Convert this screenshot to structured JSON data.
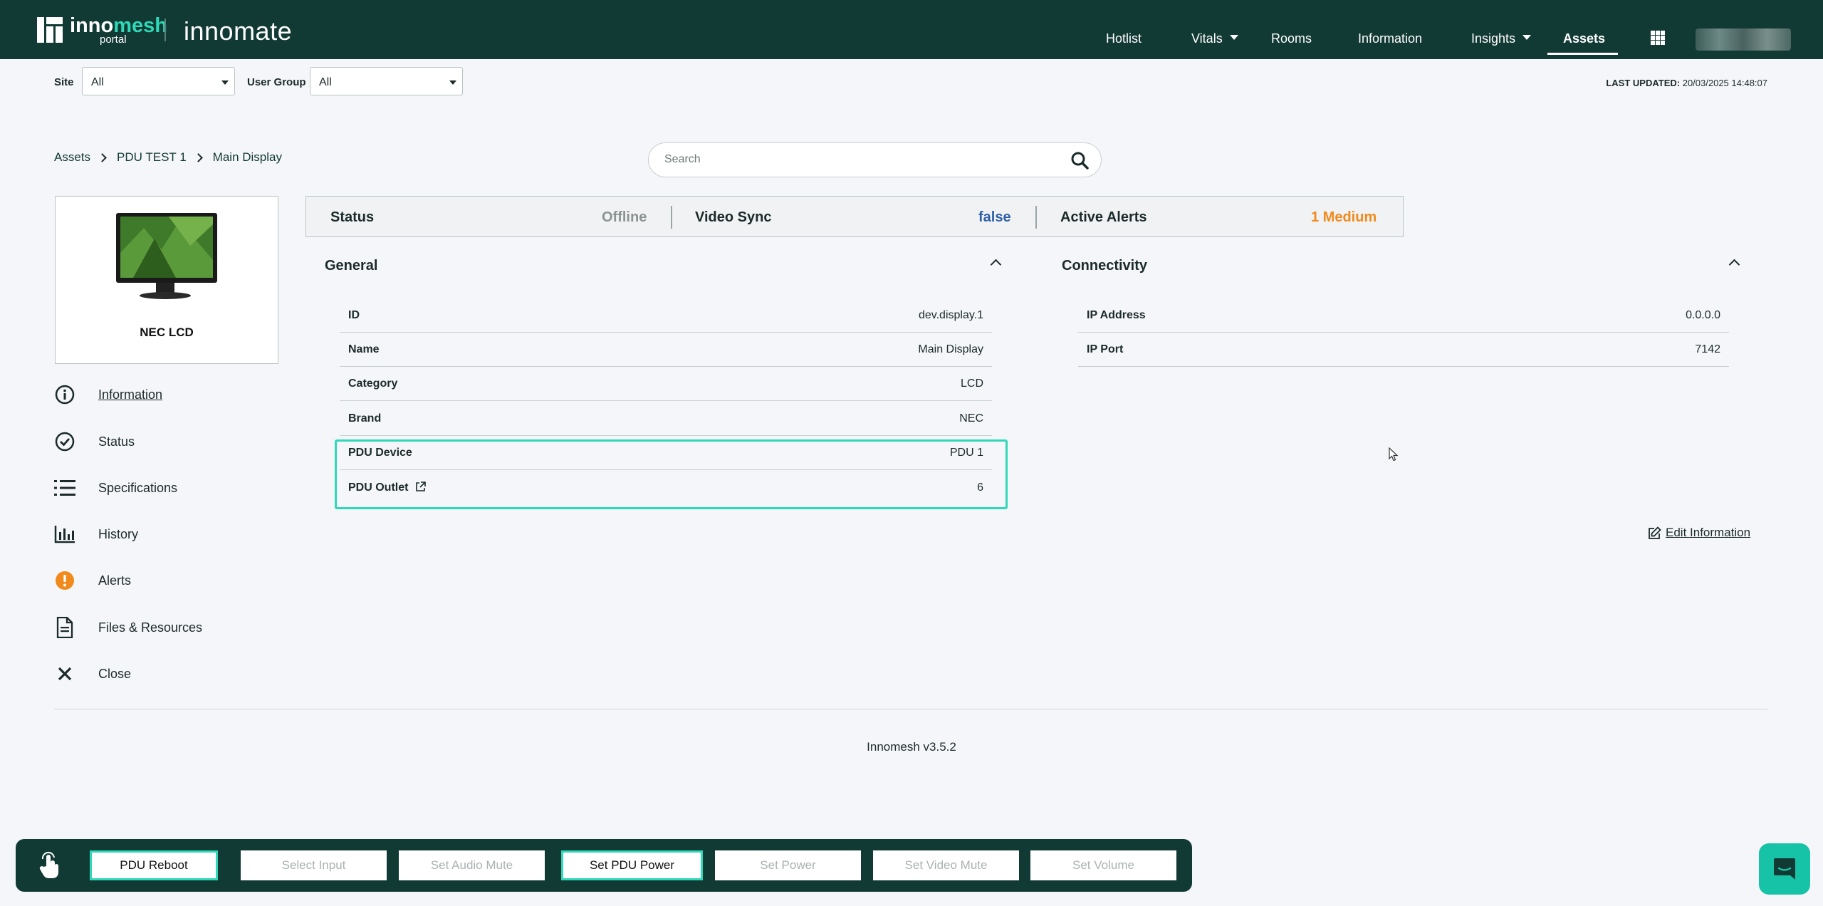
{
  "header": {
    "logo_inno": "inno",
    "logo_mesh": "mesh",
    "logo_portal": "portal",
    "app_name": "innomate",
    "nav": [
      {
        "label": "Hotlist",
        "dropdown": false
      },
      {
        "label": "Vitals",
        "dropdown": true
      },
      {
        "label": "Rooms",
        "dropdown": false
      },
      {
        "label": "Information",
        "dropdown": false
      },
      {
        "label": "Insights",
        "dropdown": true
      },
      {
        "label": "Assets",
        "dropdown": false,
        "active": true
      }
    ],
    "apps_icon": "grid-icon"
  },
  "filters": {
    "site_label": "Site",
    "site_value": "All",
    "user_group_label": "User Group",
    "user_group_value": "All",
    "last_updated_label": "LAST UPDATED:",
    "last_updated_value": "20/03/2025 14:48:07"
  },
  "breadcrumb": [
    "Assets",
    "PDU TEST 1",
    "Main Display"
  ],
  "search": {
    "placeholder": "Search"
  },
  "asset": {
    "name": "NEC LCD"
  },
  "side_menu": [
    {
      "label": "Information",
      "icon": "info-icon",
      "active": true
    },
    {
      "label": "Status",
      "icon": "check-circle-icon"
    },
    {
      "label": "Specifications",
      "icon": "list-icon"
    },
    {
      "label": "History",
      "icon": "bar-chart-icon"
    },
    {
      "label": "Alerts",
      "icon": "alert-icon"
    },
    {
      "label": "Files & Resources",
      "icon": "document-icon"
    },
    {
      "label": "Close",
      "icon": "close-icon"
    }
  ],
  "status_bar": {
    "status_label": "Status",
    "status_value": "Offline",
    "video_sync_label": "Video Sync",
    "video_sync_value": "false",
    "active_alerts_label": "Active Alerts",
    "active_alerts_value": "1 Medium",
    "colors": {
      "offline": "#8a9392",
      "false": "#2e5fa8",
      "alert": "#f08a1c"
    }
  },
  "general": {
    "title": "General",
    "rows": [
      {
        "key": "ID",
        "value": "dev.display.1"
      },
      {
        "key": "Name",
        "value": "Main Display"
      },
      {
        "key": "Category",
        "value": "LCD"
      },
      {
        "key": "Brand",
        "value": "NEC"
      },
      {
        "key": "PDU Device",
        "value": "PDU 1"
      },
      {
        "key": "PDU Outlet",
        "value": "6"
      }
    ]
  },
  "connectivity": {
    "title": "Connectivity",
    "rows": [
      {
        "key": "IP Address",
        "value": "0.0.0.0"
      },
      {
        "key": "IP Port",
        "value": "7142"
      }
    ]
  },
  "edit_information": "Edit Information",
  "version": "Innomesh v3.5.2",
  "actions": [
    {
      "label": "PDU Reboot",
      "enabled": true
    },
    {
      "label": "Select Input",
      "enabled": false
    },
    {
      "label": "Set Audio Mute",
      "enabled": false
    },
    {
      "label": "Set PDU Power",
      "enabled": true
    },
    {
      "label": "Set Power",
      "enabled": false
    },
    {
      "label": "Set Video Mute",
      "enabled": false
    },
    {
      "label": "Set Volume",
      "enabled": false
    }
  ],
  "theme": {
    "header_bg": "#123a35",
    "accent": "#2fd9b8",
    "chat_bg": "#17c3a7"
  }
}
